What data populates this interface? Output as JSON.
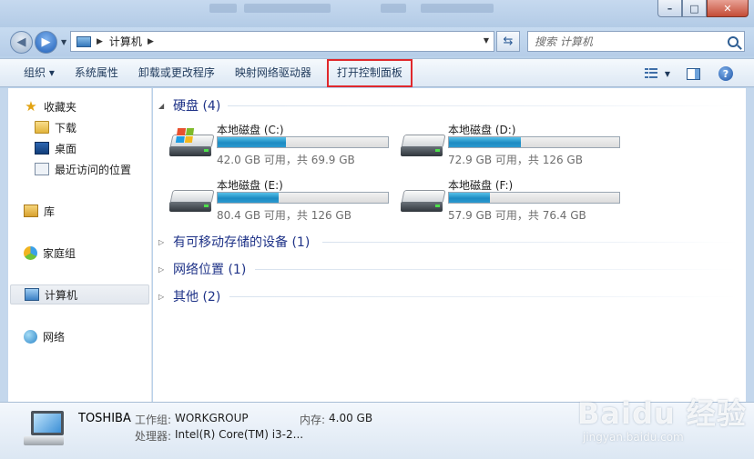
{
  "window": {
    "minimize": "–",
    "maximize": "□",
    "close": "✕"
  },
  "address": {
    "crumb": "计算机",
    "search_placeholder": "搜索 计算机"
  },
  "toolbar": {
    "items": [
      "组织 ▾",
      "系统属性",
      "卸载或更改程序",
      "映射网络驱动器",
      "打开控制面板"
    ],
    "help": "?"
  },
  "sidebar": {
    "favorites": "收藏夹",
    "downloads": "下载",
    "desktop": "桌面",
    "recent": "最近访问的位置",
    "libraries": "库",
    "homegroup": "家庭组",
    "computer": "计算机",
    "network": "网络"
  },
  "groups": {
    "hdd": "硬盘 (4)",
    "removable": "有可移动存储的设备 (1)",
    "network": "网络位置 (1)",
    "other": "其他 (2)"
  },
  "drives": [
    {
      "name": "本地磁盘 (C:)",
      "free": "42.0 GB 可用，共 69.9 GB",
      "used_fraction": 0.4,
      "system": true
    },
    {
      "name": "本地磁盘 (D:)",
      "free": "72.9 GB 可用，共 126 GB",
      "used_fraction": 0.42,
      "system": false
    },
    {
      "name": "本地磁盘 (E:)",
      "free": "80.4 GB 可用，共 126 GB",
      "used_fraction": 0.36,
      "system": false
    },
    {
      "name": "本地磁盘 (F:)",
      "free": "57.9 GB 可用，共 76.4 GB",
      "used_fraction": 0.24,
      "system": false
    }
  ],
  "details": {
    "name": "TOSHIBA",
    "workgroup_label": "工作组:",
    "workgroup": "WORKGROUP",
    "memory_label": "内存:",
    "memory": "4.00 GB",
    "cpu_label": "处理器:",
    "cpu": "Intel(R) Core(TM) i3-2..."
  },
  "watermark": {
    "logo": "Baidu 经验",
    "url": "jingyan.baidu.com"
  },
  "colors": {
    "highlight_box": "#e0282c",
    "drive_fill": "#1d8bc2",
    "group_header": "#1e3287"
  }
}
